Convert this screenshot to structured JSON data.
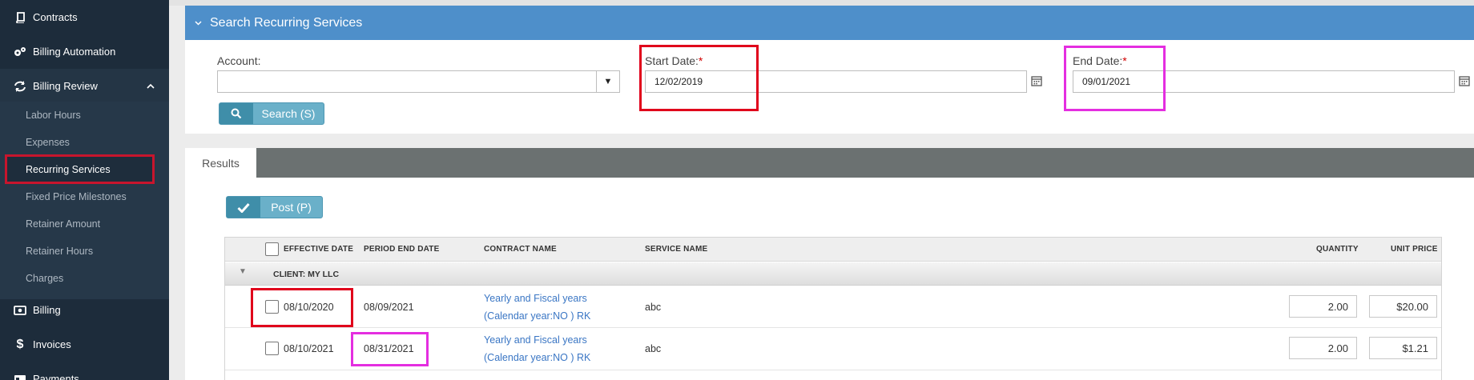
{
  "sidebar": {
    "items": [
      {
        "label": "Contracts",
        "icon": "book-icon"
      },
      {
        "label": "Billing Automation",
        "icon": "gears-icon"
      },
      {
        "label": "Billing Review",
        "icon": "refresh-icon",
        "expanded": true
      },
      {
        "label": "Billing",
        "icon": "money-icon"
      },
      {
        "label": "Invoices",
        "icon": "dollar-icon"
      },
      {
        "label": "Payments",
        "icon": "payments-icon"
      }
    ],
    "subitems": [
      {
        "label": "Labor Hours"
      },
      {
        "label": "Expenses"
      },
      {
        "label": "Recurring Services",
        "selected": true
      },
      {
        "label": "Fixed Price Milestones"
      },
      {
        "label": "Retainer Amount"
      },
      {
        "label": "Retainer Hours"
      },
      {
        "label": "Charges"
      }
    ]
  },
  "search": {
    "title": "Search Recurring Services",
    "account_label": "Account:",
    "account_value": "",
    "start_label": "Start Date:",
    "start_value": "12/02/2019",
    "end_label": "End Date:",
    "end_value": "09/01/2021",
    "required_mark": "*",
    "button_label": "Search (S)"
  },
  "results": {
    "tab_label": "Results",
    "post_label": "Post (P)",
    "columns": {
      "effective_date": "EFFECTIVE DATE",
      "period_end_date": "PERIOD END DATE",
      "contract_name": "CONTRACT NAME",
      "service_name": "SERVICE NAME",
      "quantity": "QUANTITY",
      "unit_price": "UNIT PRICE"
    },
    "group_label": "CLIENT: MY LLC",
    "rows": [
      {
        "effective_date": "08/10/2020",
        "period_end_date": "08/09/2021",
        "contract_line1": "Yearly and Fiscal years",
        "contract_line2": "(Calendar year:NO ) RK",
        "service_name": "abc",
        "quantity": "2.00",
        "unit_price": "$20.00"
      },
      {
        "effective_date": "08/10/2021",
        "period_end_date": "08/31/2021",
        "contract_line1": "Yearly and Fiscal years",
        "contract_line2": "(Calendar year:NO ) RK",
        "service_name": "abc",
        "quantity": "2.00",
        "unit_price": "$1.21"
      }
    ]
  },
  "colors": {
    "sidebar_bg": "#1d2c3b",
    "header_blue": "#4e8fca",
    "button_teal": "#6ab0c9",
    "highlight_red": "#e0001b",
    "highlight_magenta": "#e42ee0",
    "link_blue": "#3a76c4"
  }
}
